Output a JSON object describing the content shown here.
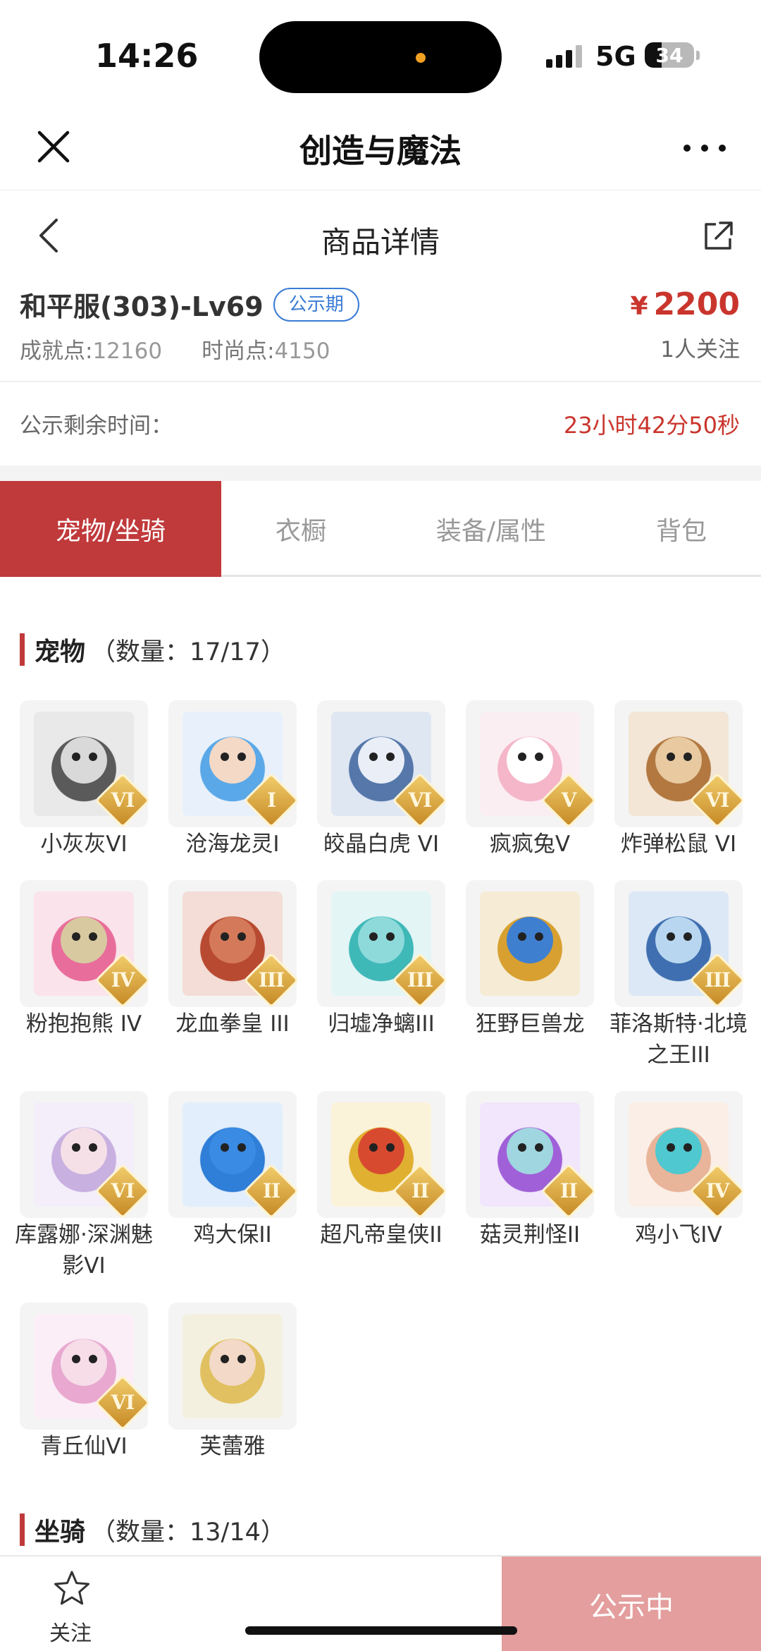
{
  "status": {
    "time": "14:26",
    "network": "5G",
    "battery": "34",
    "battery_level": 0.34
  },
  "header": {
    "title": "创造与魔法"
  },
  "nav": {
    "title": "商品详情"
  },
  "product": {
    "name": "和平服(303)-Lv69",
    "badge": "公示期",
    "price": "2200",
    "currency": "¥",
    "achievement_label": "成就点:",
    "achievement_value": "12160",
    "fashion_label": "时尚点:",
    "fashion_value": "4150",
    "followers": "1人关注"
  },
  "notice": {
    "label": "公示剩余时间：",
    "timer": "23小时42分50秒"
  },
  "tabs": [
    {
      "label": "宠物/坐骑",
      "active": true
    },
    {
      "label": "衣橱",
      "active": false
    },
    {
      "label": "装备/属性",
      "active": false
    },
    {
      "label": "背包",
      "active": false
    }
  ],
  "pets_section": {
    "title": "宠物",
    "count": "（数量：17/17）"
  },
  "mounts_section": {
    "title": "坐骑",
    "count": "（数量：13/14）"
  },
  "pets": [
    {
      "name": "小灰灰VI",
      "grade": "VI",
      "color": "#5a5a5a",
      "bg": "#e9e9e9",
      "face": "#d9d9d9"
    },
    {
      "name": "沧海龙灵I",
      "grade": "I",
      "color": "#5aa8e8",
      "bg": "#e8f1fb",
      "face": "#f4d9c7"
    },
    {
      "name": "皎晶白虎 VI",
      "grade": "VI",
      "color": "#5577aa",
      "bg": "#dfe7f3",
      "face": "#e9eef7"
    },
    {
      "name": "疯疯兔V",
      "grade": "V",
      "color": "#f4b6c8",
      "bg": "#fbeef3",
      "face": "#ffffff"
    },
    {
      "name": "炸弹松鼠 VI",
      "grade": "VI",
      "color": "#b27840",
      "bg": "#f3e6d6",
      "face": "#e8c9a0"
    },
    {
      "name": "粉抱抱熊 IV",
      "grade": "IV",
      "color": "#e86d9a",
      "bg": "#fbe3ec",
      "face": "#d8c9a0"
    },
    {
      "name": "龙血拳皇 III",
      "grade": "III",
      "color": "#b84a32",
      "bg": "#f3ddd6",
      "face": "#d47a5a"
    },
    {
      "name": "归墟净螭III",
      "grade": "III",
      "color": "#3fb8b8",
      "bg": "#e3f5f5",
      "face": "#8edada"
    },
    {
      "name": "狂野巨兽龙",
      "grade": "",
      "color": "#d8a030",
      "bg": "#f6ecd6",
      "face": "#3f7fd0"
    },
    {
      "name": "菲洛斯特·北境之王III",
      "grade": "III",
      "color": "#3f6fb0",
      "bg": "#dce8f6",
      "face": "#b8d6f0"
    },
    {
      "name": "库露娜·深渊魅影VI",
      "grade": "VI",
      "color": "#c8b0e0",
      "bg": "#f3eefa",
      "face": "#f6e0e8"
    },
    {
      "name": "鸡大保II",
      "grade": "II",
      "color": "#2f7ed8",
      "bg": "#e2eefb",
      "face": "#3a8be3"
    },
    {
      "name": "超凡帝皇侠II",
      "grade": "II",
      "color": "#e0b030",
      "bg": "#fbf2da",
      "face": "#d84a30"
    },
    {
      "name": "菇灵荆怪II",
      "grade": "II",
      "color": "#a060d8",
      "bg": "#f1e6fb",
      "face": "#9fd6e0"
    },
    {
      "name": "鸡小飞IV",
      "grade": "IV",
      "color": "#e8b49a",
      "bg": "#fbeee6",
      "face": "#4fc8d0"
    },
    {
      "name": "青丘仙VI",
      "grade": "VI",
      "color": "#e8a8d0",
      "bg": "#fbeef6",
      "face": "#f6dde8"
    },
    {
      "name": "芙蕾雅",
      "grade": "",
      "color": "#e0c060",
      "bg": "#f3f0e0",
      "face": "#f3d9c8"
    }
  ],
  "bottom": {
    "follow": "关注",
    "status": "公示中"
  }
}
